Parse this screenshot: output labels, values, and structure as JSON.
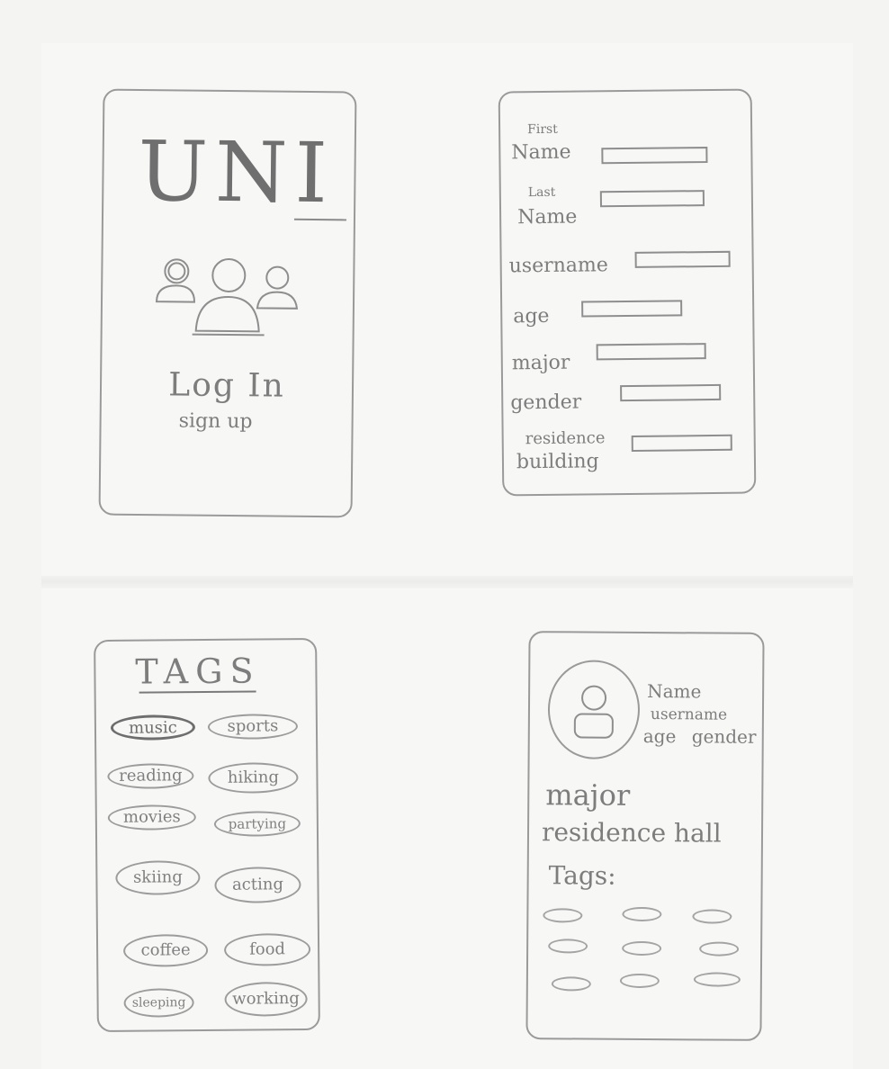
{
  "login": {
    "logo": "UNI",
    "login_label": "Log In",
    "signup_label": "sign up"
  },
  "form": {
    "first_top": "First",
    "first_bottom": "Name",
    "last_top": "Last",
    "last_bottom": "Name",
    "username": "username",
    "age": "age",
    "major": "major",
    "gender": "gender",
    "residence_top": "residence",
    "residence_bottom": "building"
  },
  "tags": {
    "title": "TAGS",
    "items": [
      "music",
      "sports",
      "reading",
      "hiking",
      "movies",
      "partying",
      "skiing",
      "acting",
      "coffee",
      "food",
      "sleeping",
      "working"
    ],
    "selected": "music"
  },
  "profile": {
    "name": "Name",
    "username": "username",
    "age": "age",
    "gender": "gender",
    "major": "major",
    "residence": "residence hall",
    "tags_label": "Tags:"
  }
}
